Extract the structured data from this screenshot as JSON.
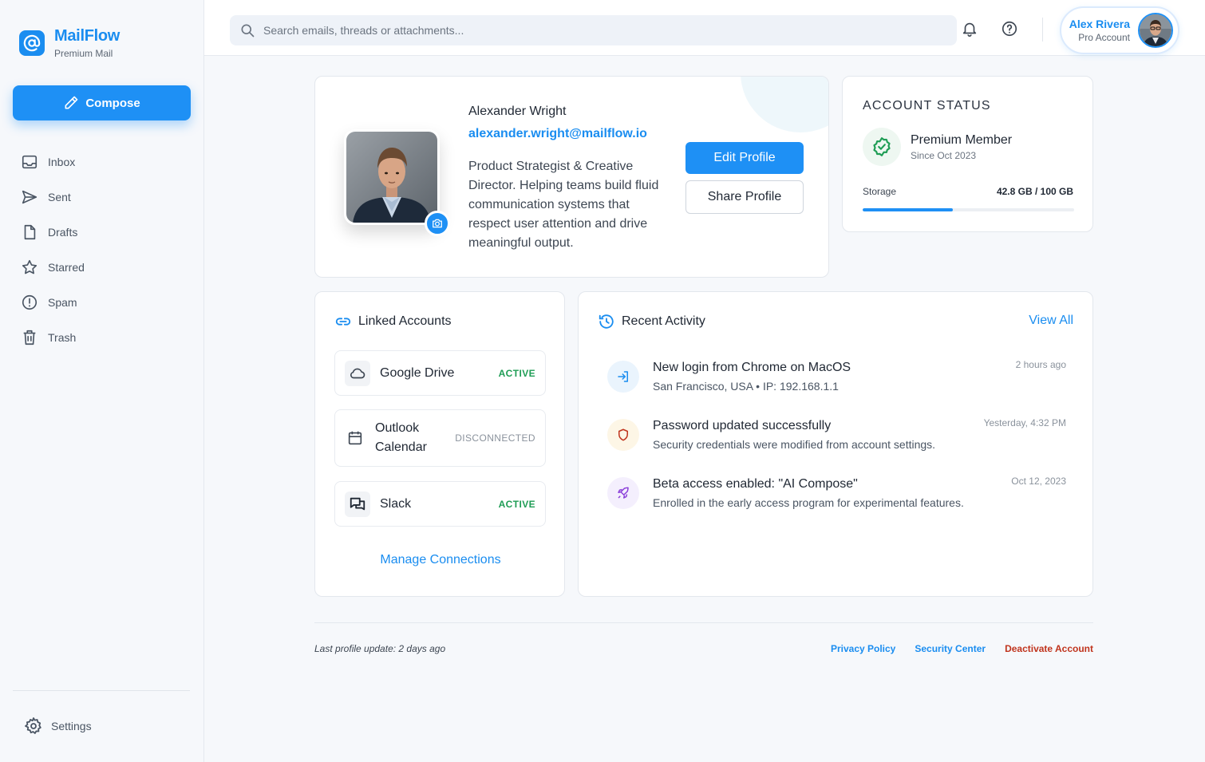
{
  "brand": {
    "name": "MailFlow",
    "subtitle": "Premium Mail"
  },
  "compose": {
    "label": "Compose"
  },
  "nav": [
    {
      "label": "Inbox",
      "icon": "inbox-icon"
    },
    {
      "label": "Sent",
      "icon": "send-icon"
    },
    {
      "label": "Drafts",
      "icon": "file-icon"
    },
    {
      "label": "Starred",
      "icon": "star-icon"
    },
    {
      "label": "Spam",
      "icon": "alert-icon"
    },
    {
      "label": "Trash",
      "icon": "trash-icon"
    }
  ],
  "settings": {
    "label": "Settings"
  },
  "search": {
    "placeholder": "Search emails, threads or attachments..."
  },
  "user": {
    "name": "Alex Rivera",
    "role": "Pro Account"
  },
  "profile": {
    "name": "Alexander Wright",
    "email": "alexander.wright@mailflow.io",
    "bio": "Product Strategist & Creative Director. Helping teams build fluid communication systems that respect user attention and drive meaningful output.",
    "edit_label": "Edit Profile",
    "share_label": "Share Profile"
  },
  "status": {
    "title": "ACCOUNT STATUS",
    "tier": "Premium Member",
    "since": "Since Oct 2023",
    "storage_label": "Storage",
    "storage_value": "42.8 GB / 100 GB",
    "storage_used_fraction": 0.428
  },
  "linked": {
    "title": "Linked Accounts",
    "accounts": [
      {
        "name": "Google Drive",
        "status": "ACTIVE",
        "icon": "cloud-icon"
      },
      {
        "name": "Outlook Calendar",
        "status": "DISCONNECTED",
        "icon": "calendar-icon"
      },
      {
        "name": "Slack",
        "status": "ACTIVE",
        "icon": "chat-icon"
      }
    ],
    "manage_label": "Manage Connections"
  },
  "activity": {
    "title": "Recent Activity",
    "view_all": "View All",
    "items": [
      {
        "title": "New login from Chrome on MacOS",
        "subtitle": "San Francisco, USA • IP: 192.168.1.1",
        "time": "2 hours ago",
        "icon": "login-icon"
      },
      {
        "title": "Password updated successfully",
        "subtitle": "Security credentials were modified from account settings.",
        "time": "Yesterday, 4:32 PM",
        "icon": "shield-icon"
      },
      {
        "title": "Beta access enabled: \"AI Compose\"",
        "subtitle": "Enrolled in the early access program for experimental features.",
        "time": "Oct 12, 2023",
        "icon": "rocket-icon"
      }
    ]
  },
  "footer": {
    "note": "Last profile update: 2 days ago",
    "privacy": "Privacy Policy",
    "security": "Security Center",
    "deactivate": "Deactivate Account"
  },
  "colors": {
    "accent": "#1e90f5",
    "success": "#1f9d55",
    "danger": "#c0341d"
  }
}
